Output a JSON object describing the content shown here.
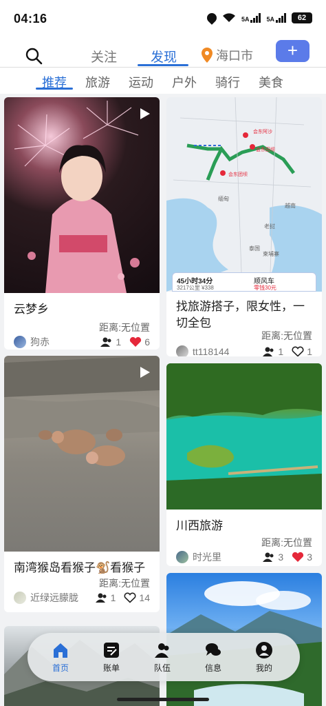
{
  "status": {
    "time": "04:16",
    "net1": "5A",
    "net2": "5A",
    "battery": "62"
  },
  "topnav": {
    "tabs": [
      {
        "label": "关注"
      },
      {
        "label": "发现"
      }
    ],
    "location": "海口市",
    "add_label": "+"
  },
  "categories": [
    "推荐",
    "旅游",
    "运动",
    "户外",
    "骑行",
    "美食"
  ],
  "posts": [
    {
      "title": "云梦乡",
      "distance": "距离:无位置",
      "author": "狗赤",
      "members": "1",
      "likes": "6",
      "liked": true
    },
    {
      "title": "找旅游搭子，限女性，一切全包",
      "distance": "距离:无位置",
      "author": "tt118144",
      "members": "1",
      "likes": "1",
      "liked": false
    },
    {
      "title": "南湾猴岛看猴子🐒看猴子",
      "distance": "距离:无位置",
      "author": "近绿远朦胧",
      "members": "1",
      "likes": "14",
      "liked": false
    },
    {
      "title": "川西旅游",
      "distance": "距离:无位置",
      "author": "时光里",
      "members": "3",
      "likes": "3",
      "liked": true
    }
  ],
  "map_overlay": {
    "duration": "45小时34分",
    "trip_detail": "3217公里 ¥338",
    "mode": "顺风车",
    "price": "零钱30元",
    "labels": [
      "会东阿沙",
      "会东田坝",
      "会东团坝",
      "老挝",
      "泰国",
      "缅甸",
      "越南",
      "柬埔寨"
    ]
  },
  "tabbar": [
    {
      "label": "首页",
      "active": true
    },
    {
      "label": "账单",
      "active": false
    },
    {
      "label": "队伍",
      "active": false
    },
    {
      "label": "信息",
      "active": false
    },
    {
      "label": "我的",
      "active": false
    }
  ],
  "colors": {
    "accent": "#2a6fd6",
    "add_button": "#5b7be9",
    "like_red": "#e5283a"
  }
}
